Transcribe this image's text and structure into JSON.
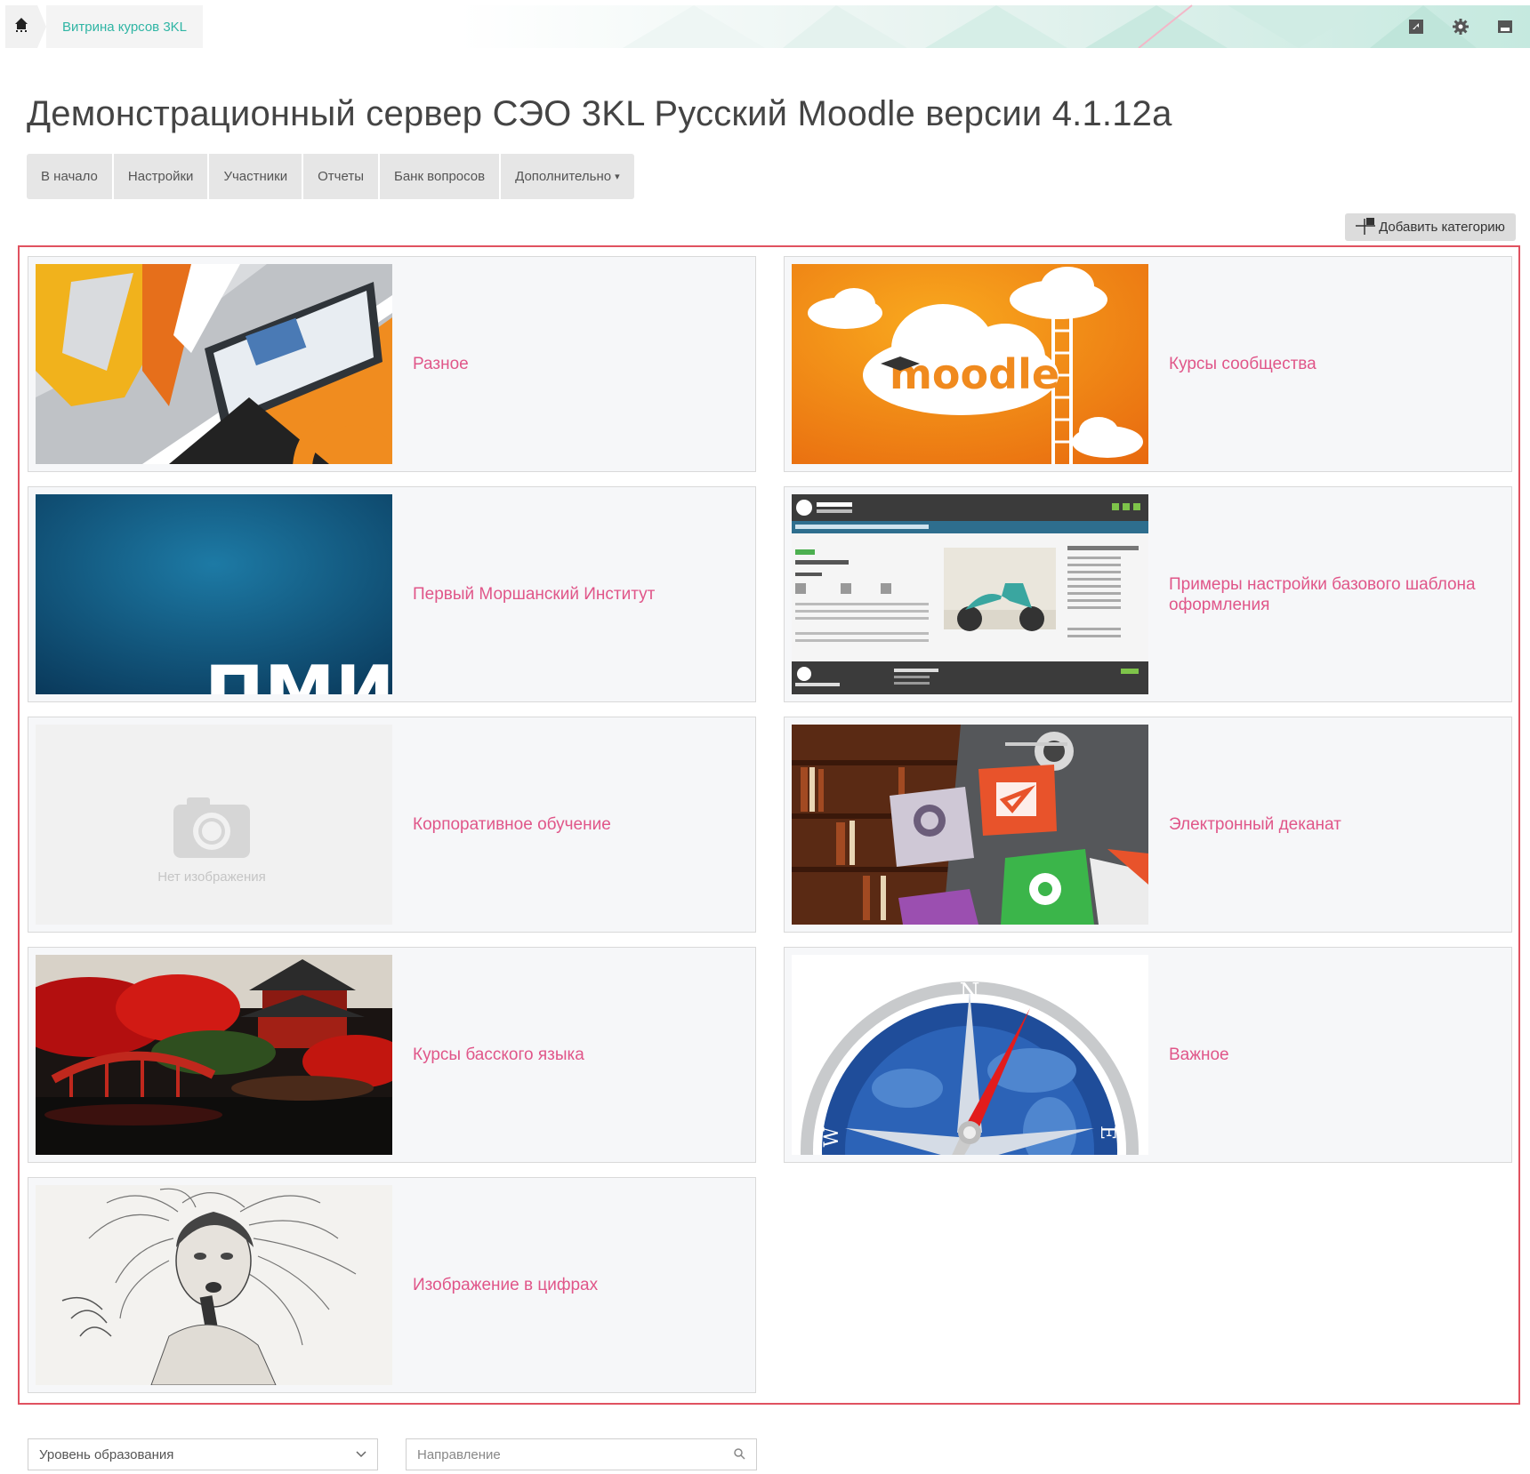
{
  "breadcrumb": {
    "home_icon": "home-icon",
    "item": "Витрина курсов 3KL"
  },
  "top_icons": [
    "send-icon",
    "gear-icon",
    "save-icon"
  ],
  "page_title": "Демонстрационный сервер СЭО 3KL Русский Moodle версии 4.1.12a",
  "nav": {
    "items": [
      "В начало",
      "Настройки",
      "Участники",
      "Отчеты",
      "Банк вопросов",
      "Дополнительно"
    ],
    "more_caret": "▾"
  },
  "add_category_label": "Добавить категорию",
  "categories": [
    {
      "title": "Разное",
      "image": "3kl-logo-laptop"
    },
    {
      "title": "Курсы сообщества",
      "image": "moodle-cloud-orange"
    },
    {
      "title": "Первый Моршанский Институт",
      "image": "pmi-blue",
      "image_text": "ПМИ"
    },
    {
      "title": "Примеры настройки базового шаблона оформления",
      "image": "website-screenshot"
    },
    {
      "title": "Корпоративное обучение",
      "image": "no-image-placeholder",
      "image_text": "Нет изображения"
    },
    {
      "title": "Электронный деканат",
      "image": "library-app-icons"
    },
    {
      "title": "Курсы басского языка",
      "image": "japanese-garden-red"
    },
    {
      "title": "Важное",
      "image": "compass",
      "image_letters": [
        "N",
        "W",
        "E"
      ]
    },
    {
      "title": "Изображение в цифрах",
      "image": "pencil-portrait"
    }
  ],
  "filters": {
    "level_placeholder": "Уровень образования",
    "direction_placeholder": "Направление"
  },
  "colors": {
    "accent_pink": "#e05689",
    "breadcrumb_teal": "#2fb5a4",
    "frame_red": "#e05260"
  }
}
